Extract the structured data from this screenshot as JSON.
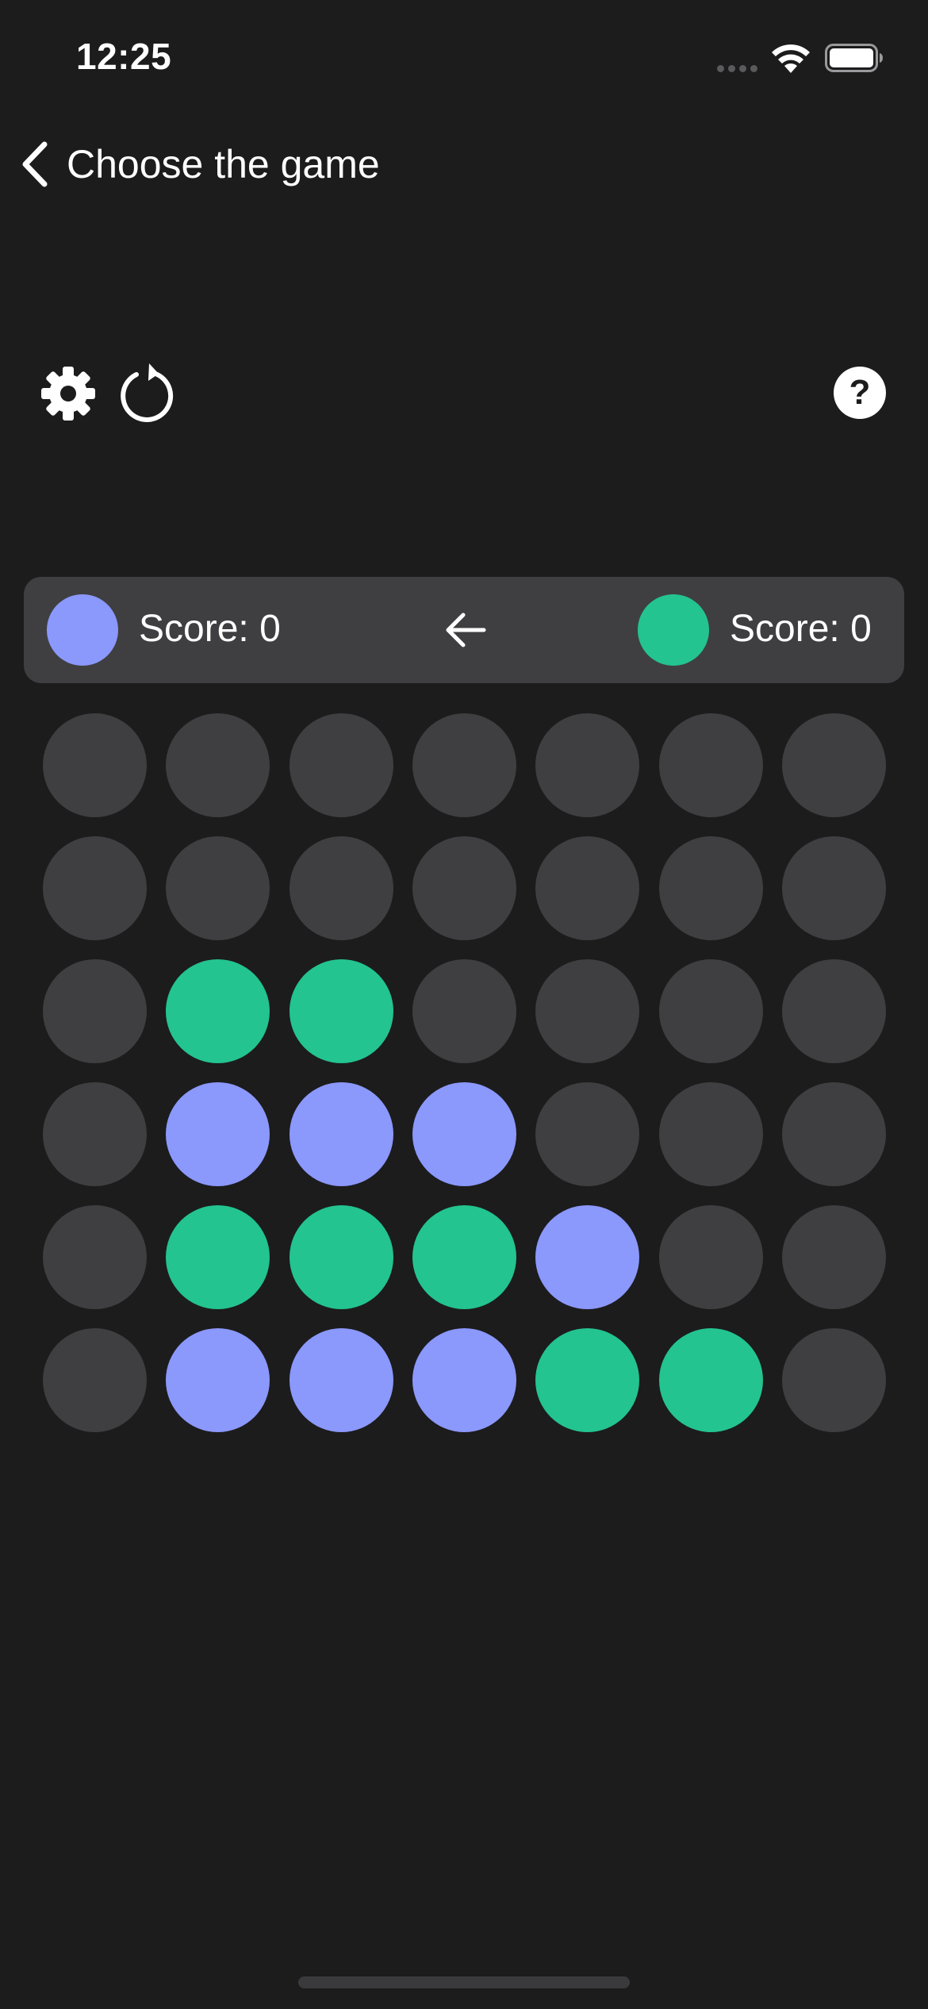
{
  "status_bar": {
    "time": "12:25"
  },
  "nav": {
    "back_label": "Choose the game"
  },
  "toolbar": {
    "settings_icon": "gear-icon",
    "restart_icon": "restart-icon",
    "help_label": "?"
  },
  "score_bar": {
    "player1": {
      "color": "#8b98fc",
      "score_text": "Score: 0"
    },
    "player2": {
      "color": "#23c48f",
      "score_text": "Score: 0"
    },
    "turn_indicator_icon": "arrow-left-icon"
  },
  "colors": {
    "empty": "#3f3f41",
    "player1": "#8b98fc",
    "player2": "#23c48f",
    "background": "#1c1c1d"
  },
  "board": {
    "columns": 7,
    "rows": 6,
    "cells": [
      [
        0,
        0,
        0,
        0,
        0,
        0,
        0
      ],
      [
        0,
        0,
        0,
        0,
        0,
        0,
        0
      ],
      [
        0,
        2,
        2,
        0,
        0,
        0,
        0
      ],
      [
        0,
        1,
        1,
        1,
        0,
        0,
        0
      ],
      [
        0,
        2,
        2,
        2,
        1,
        0,
        0
      ],
      [
        0,
        1,
        1,
        1,
        2,
        2,
        0
      ]
    ]
  }
}
